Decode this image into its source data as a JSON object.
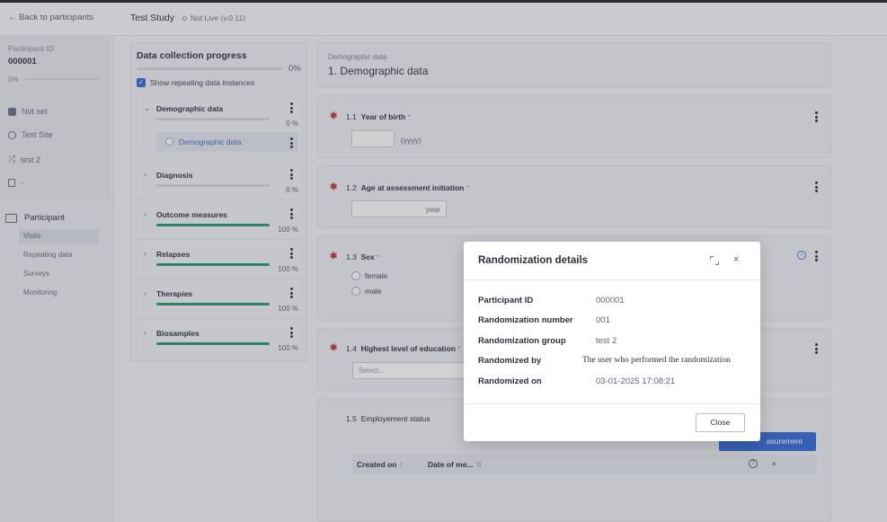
{
  "topbar": {
    "back_label": "← Back to participants",
    "study_name": "Test Study",
    "study_status": "Not Live (v.0.11)"
  },
  "sidebar": {
    "participant_id_label": "Participant ID",
    "participant_id": "000001",
    "progress_pct": "0%",
    "rows": [
      {
        "icon": "square-icon",
        "label": "Not set"
      },
      {
        "icon": "location-icon",
        "label": "Test Site"
      },
      {
        "icon": "shuffle-icon",
        "label": "test 2"
      },
      {
        "icon": "document-icon",
        "label": "-"
      }
    ],
    "section_label": "Participant",
    "nav": [
      "Visits",
      "Repeating data",
      "Surveys",
      "Monitoring"
    ]
  },
  "progress": {
    "title": "Data collection progress",
    "overall_pct": "0%",
    "show_repeating_label": "Show repeating data instances",
    "show_repeating_checked": true,
    "sections": [
      {
        "name": "Demographic data",
        "pct": "0 %",
        "fill": 0,
        "expanded": true
      },
      {
        "name": "Diagnosis",
        "pct": "0 %",
        "fill": 0,
        "expanded": false
      },
      {
        "name": "Outcome measures",
        "pct": "100 %",
        "fill": 100,
        "expanded": false
      },
      {
        "name": "Relapses",
        "pct": "100 %",
        "fill": 100,
        "expanded": false
      },
      {
        "name": "Therapies",
        "pct": "100 %",
        "fill": 100,
        "expanded": false
      },
      {
        "name": "Biosamples",
        "pct": "100 %",
        "fill": 100,
        "expanded": false
      }
    ],
    "sub_item": "Demographic data"
  },
  "form": {
    "crumb": "Demographic data",
    "title": "1. Demographic data",
    "q1": {
      "num": "1.1",
      "label": "Year of birth",
      "req": "*",
      "hint": "(yyyy)"
    },
    "q2": {
      "num": "1.2",
      "label": "Age at assessment initiation",
      "req": "*",
      "unit": "year"
    },
    "q3": {
      "num": "1.3",
      "label": "Sex",
      "req": "*",
      "options": [
        "female",
        "male"
      ]
    },
    "q4": {
      "num": "1.4",
      "label": "Highest level of education",
      "req": "*",
      "placeholder": "Select..."
    },
    "q5": {
      "num": "1.5",
      "label": "Employement status"
    },
    "add_button": "asurement",
    "table": {
      "col1": "Created on",
      "col1_sort": "↑",
      "col2": "Date of me...",
      "col2_sort": "⇅",
      "help": "?",
      "cols_icon": "⚹"
    }
  },
  "modal": {
    "title": "Randomization details",
    "rows": [
      {
        "k": "Participant ID",
        "v": "000001"
      },
      {
        "k": "Randomization number",
        "v": "001"
      },
      {
        "k": "Randomization group",
        "v": "test 2"
      },
      {
        "k": "Randomized by",
        "v": "The user who performed the randomization"
      },
      {
        "k": "Randomized on",
        "v": "03-01-2025 17:08:21"
      }
    ],
    "close_label": "Close",
    "close_x": "×"
  },
  "colors": {
    "accent": "#3a6fd8",
    "progress_fill": "#2f9a74",
    "required": "#c8343f"
  }
}
